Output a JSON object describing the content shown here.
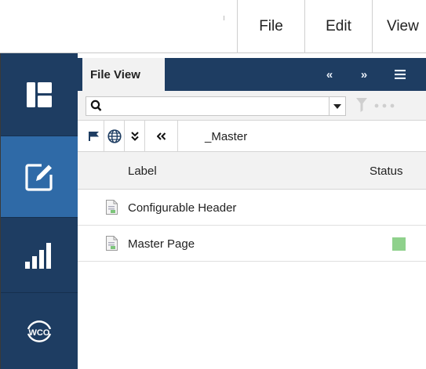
{
  "menubar": {
    "items": [
      "File",
      "Edit",
      "View"
    ]
  },
  "rail": {
    "items": [
      {
        "icon": "layout-panels-icon",
        "active": false
      },
      {
        "icon": "edit-pencil-icon",
        "active": true
      },
      {
        "icon": "signal-bars-icon",
        "active": false
      },
      {
        "icon": "wco-logo-icon",
        "label": "WCO",
        "active": false
      }
    ]
  },
  "panel": {
    "tab_label": "File View",
    "tab_icons": [
      "collapse-left-icon",
      "expand-right-icon",
      "hamburger-menu-icon"
    ],
    "search": {
      "value": "",
      "placeholder": ""
    },
    "toolbar": {
      "icons": [
        "flag-icon",
        "globe-icon",
        "double-chevron-down-icon",
        "double-chevron-left-icon"
      ],
      "breadcrumb": "_Master"
    },
    "columns": {
      "label": "Label",
      "status": "Status"
    },
    "rows": [
      {
        "label": "Configurable Header",
        "status_color": ""
      },
      {
        "label": "Master Page",
        "status_color": "#8fd18c"
      }
    ]
  },
  "colors": {
    "rail_bg": "#1e3d62",
    "rail_active": "#2f6aa7",
    "status_green": "#8fd18c"
  }
}
